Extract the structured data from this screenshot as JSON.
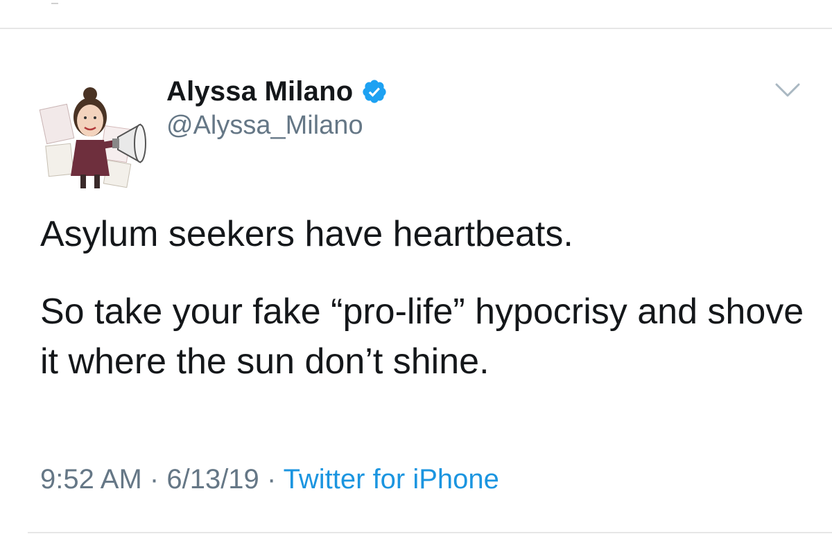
{
  "tweet": {
    "display_name": "Alyssa Milano",
    "handle": "@Alyssa_Milano",
    "verified": true,
    "text_line_1": "Asylum seekers have heartbeats.",
    "text_line_2": "So take your fake “pro-life” hypocrisy and shove it where the sun don’t shine.",
    "time": "9:52 AM",
    "date": "6/13/19",
    "source": "Twitter for iPhone",
    "separator": "·"
  },
  "icons": {
    "verified": "verified-badge-icon",
    "more": "chevron-down-icon",
    "avatar": "avatar-illustration"
  },
  "colors": {
    "text": "#14171a",
    "secondary": "#657786",
    "link": "#1b95e0",
    "verified": "#1da1f2",
    "divider": "#e6e6e6"
  }
}
